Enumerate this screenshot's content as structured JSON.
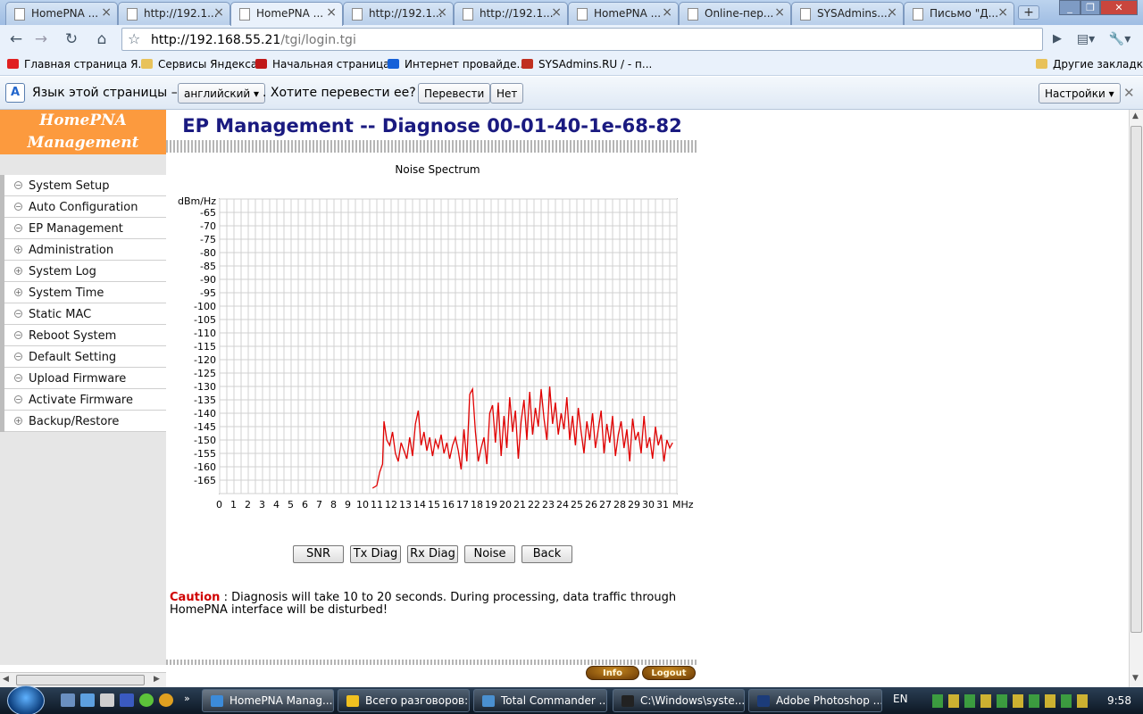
{
  "browser": {
    "tabs": [
      {
        "label": "HomePNA ..."
      },
      {
        "label": "http://192.1..."
      },
      {
        "label": "HomePNA ..."
      },
      {
        "label": "http://192.1..."
      },
      {
        "label": "http://192.1..."
      },
      {
        "label": "HomePNA ..."
      },
      {
        "label": "Online-пер..."
      },
      {
        "label": "SYSAdmins...."
      },
      {
        "label": "Письмо \"Д..."
      }
    ],
    "active_tab": 2,
    "url_host": "http://192.168.55.21",
    "url_path": "/tgi/login.tgi",
    "bookmarks": [
      {
        "label": "Главная страница Я...",
        "icon": "yandex-icon",
        "color": "#e02020"
      },
      {
        "label": "Сервисы Яндекса",
        "icon": "folder-icon",
        "color": "#e8c25a"
      },
      {
        "label": "Начальная страница",
        "icon": "devil-icon",
        "color": "#c01818"
      },
      {
        "label": "Интернет провайде...",
        "icon": "globe-icon",
        "color": "#1560d8"
      },
      {
        "label": "SYSAdmins.RU / - п...",
        "icon": "sysadmins-icon",
        "color": "#c03020"
      }
    ],
    "other_bookmarks": "Другие закладки"
  },
  "translate": {
    "prompt": "Язык этой страницы –",
    "language": "английский",
    "question": ". Хотите перевести ее?",
    "translate_btn": "Перевести",
    "no_btn": "Нет",
    "settings_btn": "Настройки"
  },
  "sidebar": {
    "logo_line1": "HomePNA",
    "logo_line2": "Management",
    "items": [
      {
        "label": "System Setup",
        "icon": "minus"
      },
      {
        "label": "Auto Configuration",
        "icon": "minus"
      },
      {
        "label": "EP Management",
        "icon": "minus"
      },
      {
        "label": "Administration",
        "icon": "plus"
      },
      {
        "label": "System Log",
        "icon": "plus"
      },
      {
        "label": "System Time",
        "icon": "plus"
      },
      {
        "label": "Static MAC",
        "icon": "minus"
      },
      {
        "label": "Reboot System",
        "icon": "minus"
      },
      {
        "label": "Default Setting",
        "icon": "minus"
      },
      {
        "label": "Upload Firmware",
        "icon": "minus"
      },
      {
        "label": "Activate Firmware",
        "icon": "minus"
      },
      {
        "label": "Backup/Restore",
        "icon": "plus"
      }
    ]
  },
  "main": {
    "title": "EP Management -- Diagnose 00-01-40-1e-68-82",
    "buttons": [
      "SNR",
      "Tx Diag",
      "Rx Diag",
      "Noise",
      "Back"
    ],
    "caution_label": "Caution",
    "caution_text": " : Diagnosis will take 10 to 20 seconds. During processing, data traffic through HomePNA interface will be disturbed!",
    "info_btn": "Info",
    "logout_btn": "Logout"
  },
  "chart_data": {
    "type": "line",
    "title": "Noise Spectrum",
    "ylabel": "dBm/Hz",
    "xlabel": "MHz",
    "xlim": [
      0,
      32
    ],
    "ylim": [
      -170,
      -60
    ],
    "yticks": [
      -65,
      -70,
      -75,
      -80,
      -85,
      -90,
      -95,
      -100,
      -105,
      -110,
      -115,
      -120,
      -125,
      -130,
      -135,
      -140,
      -145,
      -150,
      -155,
      -160,
      -165
    ],
    "xticks": [
      0,
      1,
      2,
      3,
      4,
      5,
      6,
      7,
      8,
      9,
      10,
      11,
      12,
      13,
      14,
      15,
      16,
      17,
      18,
      19,
      20,
      21,
      22,
      23,
      24,
      25,
      26,
      27,
      28,
      29,
      30,
      31
    ],
    "grid": true,
    "color": "#e00000",
    "series": [
      {
        "x": [
          10.7,
          11.0,
          11.2,
          11.4,
          11.5,
          11.7,
          11.9,
          12.1,
          12.3,
          12.5,
          12.7,
          12.9,
          13.1,
          13.3,
          13.5,
          13.7,
          13.9,
          14.1,
          14.3,
          14.5,
          14.7,
          14.9,
          15.1,
          15.3,
          15.5,
          15.7,
          15.9,
          16.1,
          16.3,
          16.5,
          16.7,
          16.9,
          17.1,
          17.3,
          17.5,
          17.7,
          17.9,
          18.1,
          18.3,
          18.5,
          18.7,
          18.9,
          19.1,
          19.3,
          19.5,
          19.7,
          19.9,
          20.1,
          20.3,
          20.5,
          20.7,
          20.9,
          21.1,
          21.3,
          21.5,
          21.7,
          21.9,
          22.1,
          22.3,
          22.5,
          22.7,
          22.9,
          23.1,
          23.3,
          23.5,
          23.7,
          23.9,
          24.1,
          24.3,
          24.5,
          24.7,
          24.9,
          25.1,
          25.3,
          25.5,
          25.7,
          25.9,
          26.1,
          26.3,
          26.5,
          26.7,
          26.9,
          27.1,
          27.3,
          27.5,
          27.7,
          27.9,
          28.1,
          28.3,
          28.5,
          28.7,
          28.9,
          29.1,
          29.3,
          29.5,
          29.7,
          29.9,
          30.1,
          30.3,
          30.5,
          30.7,
          30.9,
          31.1,
          31.3,
          31.5,
          31.7
        ],
        "y": [
          -168,
          -167,
          -162,
          -159,
          -143,
          -150,
          -152,
          -147,
          -155,
          -158,
          -151,
          -154,
          -157,
          -149,
          -156,
          -144,
          -139,
          -152,
          -147,
          -154,
          -149,
          -156,
          -150,
          -153,
          -148,
          -155,
          -151,
          -157,
          -152,
          -149,
          -154,
          -161,
          -146,
          -158,
          -133,
          -131,
          -147,
          -158,
          -153,
          -149,
          -159,
          -140,
          -137,
          -151,
          -136,
          -156,
          -141,
          -153,
          -134,
          -147,
          -139,
          -157,
          -143,
          -135,
          -150,
          -132,
          -148,
          -138,
          -145,
          -131,
          -142,
          -150,
          -130,
          -144,
          -136,
          -148,
          -140,
          -146,
          -134,
          -150,
          -141,
          -152,
          -138,
          -147,
          -155,
          -143,
          -150,
          -140,
          -153,
          -146,
          -139,
          -155,
          -144,
          -151,
          -141,
          -156,
          -148,
          -143,
          -153,
          -146,
          -158,
          -142,
          -150,
          -147,
          -155,
          -141,
          -153,
          -149,
          -157,
          -145,
          -152,
          -148,
          -158,
          -150,
          -153,
          -151
        ]
      }
    ]
  },
  "taskbar": {
    "tasks": [
      {
        "label": "HomePNA Manag...",
        "icon": "chrome-icon",
        "color": "#3c8bd9"
      },
      {
        "label": "Всего разговоров:...",
        "icon": "chat-icon",
        "color": "#f0c020"
      },
      {
        "label": "Total Commander ...",
        "icon": "totalcmd-icon",
        "color": "#4a90d0"
      },
      {
        "label": "C:\\Windows\\syste...",
        "icon": "cmd-icon",
        "color": "#222222"
      },
      {
        "label": "Adobe Photoshop ...",
        "icon": "photoshop-icon",
        "color": "#1c3c7a"
      }
    ],
    "lang": "EN",
    "clock": "9:58"
  }
}
